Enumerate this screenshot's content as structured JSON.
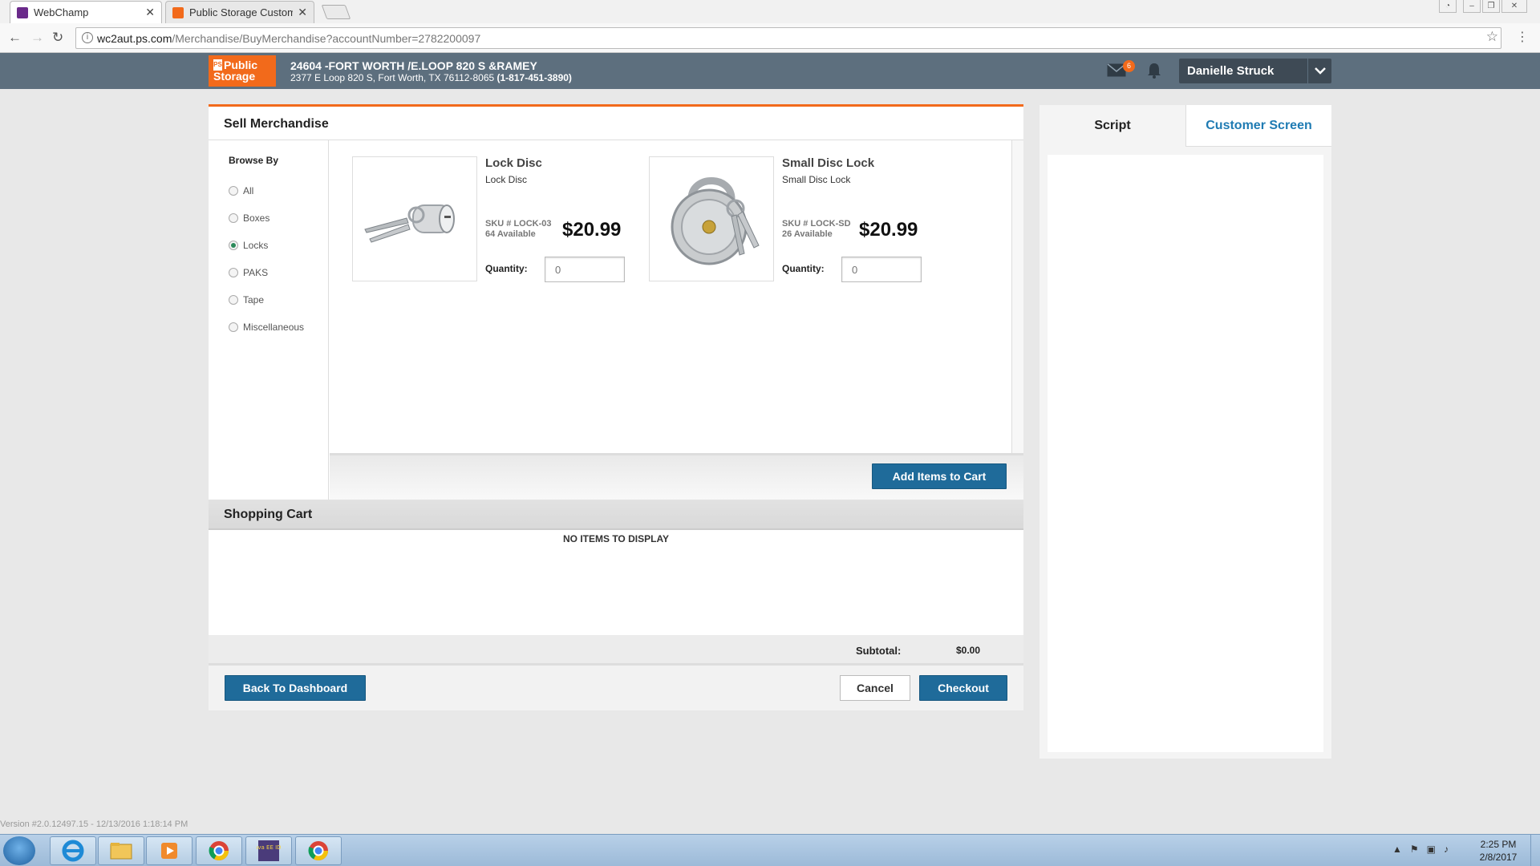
{
  "browser": {
    "tabs": [
      {
        "label": "WebChamp",
        "active": true
      },
      {
        "label": "Public Storage Customer",
        "active": false
      }
    ],
    "url_host": "wc2aut.ps.com",
    "url_path": "/Merchandise/BuyMerchandise?accountNumber=2782200097"
  },
  "header": {
    "logo_line1": "Public",
    "logo_line2": "Storage",
    "logo_mark": "PS",
    "store_name": "24604 -FORT WORTH /E.LOOP 820 S &RAMEY",
    "store_address": "2377 E Loop 820 S, Fort Worth, TX 76112-8065",
    "store_phone": "(1-817-451-3890)",
    "mail_count": "6",
    "user_name": "Danielle Struck"
  },
  "main": {
    "title": "Sell Merchandise",
    "browse_by_label": "Browse By",
    "categories": [
      {
        "label": "All",
        "selected": false
      },
      {
        "label": "Boxes",
        "selected": false
      },
      {
        "label": "Locks",
        "selected": true
      },
      {
        "label": "PAKS",
        "selected": false
      },
      {
        "label": "Tape",
        "selected": false
      },
      {
        "label": "Miscellaneous",
        "selected": false
      }
    ],
    "products": [
      {
        "name": "Lock Disc",
        "description": "Lock Disc",
        "sku": "SKU # LOCK-03",
        "available": "64 Available",
        "price": "$20.99",
        "quantity_label": "Quantity:",
        "quantity_placeholder": "0"
      },
      {
        "name": "Small Disc Lock",
        "description": "Small Disc Lock",
        "sku": "SKU # LOCK-SD",
        "available": "26 Available",
        "price": "$20.99",
        "quantity_label": "Quantity:",
        "quantity_placeholder": "0"
      }
    ],
    "add_to_cart_label": "Add Items to Cart"
  },
  "cart": {
    "title": "Shopping Cart",
    "empty_text": "NO ITEMS TO DISPLAY",
    "subtotal_label": "Subtotal:",
    "subtotal_value": "$0.00",
    "back_label": "Back To Dashboard",
    "cancel_label": "Cancel",
    "checkout_label": "Checkout"
  },
  "right_panel": {
    "tabs": [
      {
        "label": "Script",
        "active": true
      },
      {
        "label": "Customer Screen",
        "active": false
      }
    ]
  },
  "version_text": "Version #2.0.12497.15 - 12/13/2016 1:18:14 PM",
  "taskbar": {
    "time": "2:25 PM",
    "date": "2/8/2017",
    "java_ee_label": "Java EE IDE"
  },
  "colors": {
    "brand_orange": "#f26a1b",
    "header_slate": "#5d6f7e",
    "button_blue": "#1f6b9a",
    "link_blue": "#1f7bb3"
  }
}
